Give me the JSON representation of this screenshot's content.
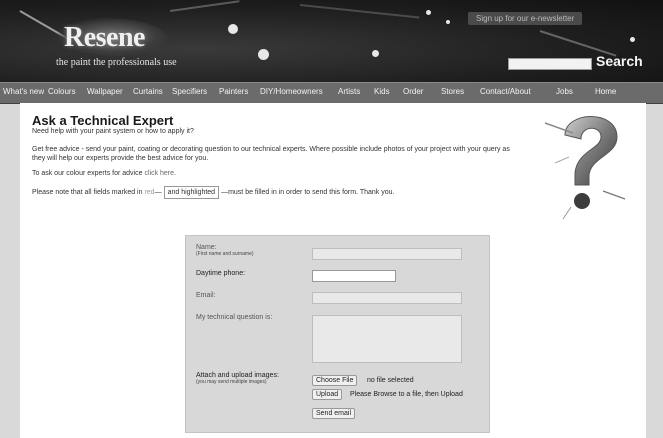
{
  "header": {
    "logo": "Resene",
    "tagline": "the paint the professionals use",
    "newsletter": "Sign up for our e-newsletter",
    "search_label": "Search"
  },
  "nav": {
    "items": [
      "What's new",
      "Colours",
      "Wallpaper",
      "Curtains",
      "Specifiers",
      "Painters",
      "DIY/Homeowners",
      "Artists",
      "Kids",
      "Order",
      "Stores",
      "Contact/About",
      "Jobs",
      "Home"
    ]
  },
  "page": {
    "title": "Ask a Technical Expert",
    "subtitle": "Need help with your paint system or how to apply it?",
    "intro": "Get free advice - send your paint, coating or decorating question to our technical experts. Where possible include photos of your project with your query as they will help our experts provide the best advice for you.",
    "colour_prefix": "To ask our colour experts for advice ",
    "colour_link": "click here",
    "colour_suffix": ".",
    "note_prefix": "Please note that all fields marked in ",
    "note_red": "red",
    "note_dash": "—",
    "note_highlight": "and highlighted",
    "note_suffix": "—must be filled in in order to send this form. Thank you."
  },
  "form": {
    "name_label": "Name:",
    "name_hint": "(First name and surname)",
    "phone_label": "Daytime phone:",
    "email_label": "Email:",
    "question_label": "My technical question is:",
    "attach_label": "Attach and upload images:",
    "attach_hint": "(you may send multiple images)",
    "choose_file": "Choose File",
    "no_file": "no file selected",
    "upload": "Upload",
    "upload_hint": "Please Browse to a file, then Upload",
    "send": "Send email"
  }
}
